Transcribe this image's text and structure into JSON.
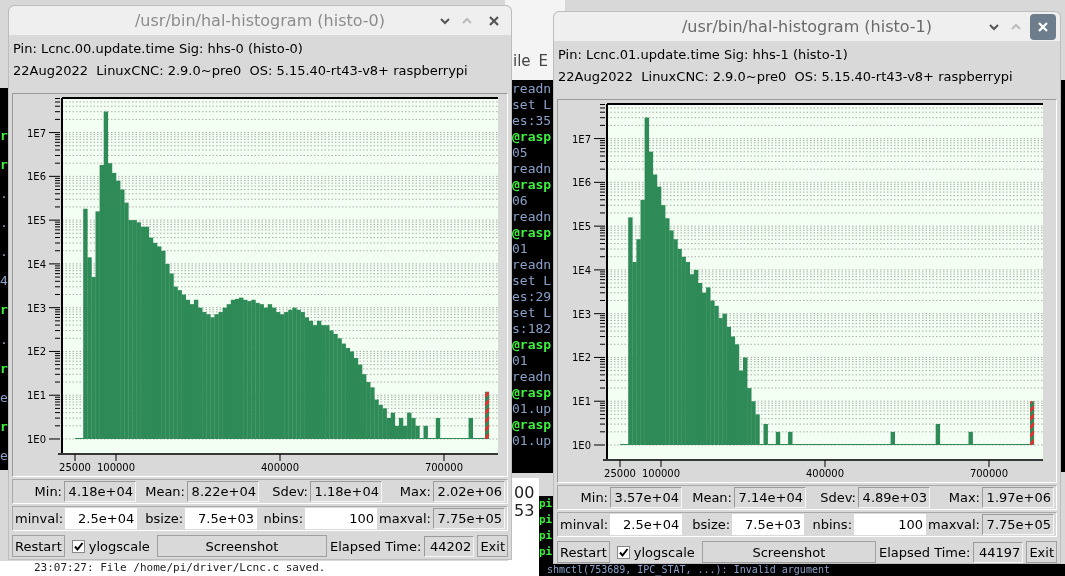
{
  "background": {
    "left_terminal": [
      {
        "text": "r",
        "kind": "prompt"
      },
      {
        "text": "r",
        "kind": "prompt"
      },
      {
        "text": ".",
        "kind": "output"
      },
      {
        "text": ".",
        "kind": "output"
      },
      {
        "text": ".",
        "kind": "output"
      },
      {
        "text": "4",
        "kind": "output"
      },
      {
        "text": "r",
        "kind": "prompt"
      },
      {
        "text": ".",
        "kind": "output"
      },
      {
        "text": "r",
        "kind": "prompt"
      },
      {
        "text": "e",
        "kind": "output"
      },
      {
        "text": "r",
        "kind": "prompt"
      },
      {
        "text": "e",
        "kind": "output"
      }
    ],
    "editor_menu": [
      "ile",
      "E"
    ],
    "middle_terminal": [
      {
        "text": "readn",
        "kind": "output"
      },
      {
        "text": "set L",
        "kind": "output"
      },
      {
        "text": "es:35",
        "kind": "output"
      },
      {
        "text": "@rasp",
        "kind": "prompt"
      },
      {
        "text": "05",
        "kind": "output"
      },
      {
        "text": "readn",
        "kind": "output"
      },
      {
        "text": "@rasp",
        "kind": "prompt"
      },
      {
        "text": "06",
        "kind": "output"
      },
      {
        "text": "readn",
        "kind": "output"
      },
      {
        "text": "@rasp",
        "kind": "prompt"
      },
      {
        "text": "01",
        "kind": "output"
      },
      {
        "text": "readn",
        "kind": "output"
      },
      {
        "text": "set L",
        "kind": "output"
      },
      {
        "text": "es:29",
        "kind": "output"
      },
      {
        "text": "set L",
        "kind": "output"
      },
      {
        "text": "s:182",
        "kind": "output"
      },
      {
        "text": "@rasp",
        "kind": "prompt"
      },
      {
        "text": "01",
        "kind": "output"
      },
      {
        "text": "readn",
        "kind": "output"
      },
      {
        "text": "@rasp",
        "kind": "prompt"
      },
      {
        "text": "01.up",
        "kind": "output"
      },
      {
        "text": "@rasp",
        "kind": "prompt"
      },
      {
        "text": "01.up",
        "kind": "output"
      }
    ],
    "log_panel": [
      "00",
      "53"
    ],
    "pi_terminal": [
      "pi",
      "pi",
      "pi",
      "pi"
    ],
    "status_message": "23:07:27: File /home/pi/driver/Lcnc.c saved.",
    "bottom_terminal": "shmctl(753689, IPC_STAT, ...): Invalid argument"
  },
  "windows": [
    {
      "title": "/usr/bin/hal-histogram (histo-0)",
      "active": false,
      "info": [
        "Pin: Lcnc.00.update.time Sig: hhs-0 (histo-0)",
        "22Aug2022  LinuxCNC: 2.9.0~pre0  OS: 5.15.40-rt43-v8+ raspberrypi"
      ],
      "histogram": {
        "y_axis_labels": [
          "1E7",
          "1E6",
          "1E5",
          "1E4",
          "1E3",
          "1E2",
          "1E1",
          "1E0"
        ],
        "x_axis_labels": [
          "25000",
          "100000",
          "400000",
          "700000"
        ]
      },
      "stats": [
        {
          "label": "Min:",
          "value": "4.18e+04"
        },
        {
          "label": "Mean:",
          "value": "8.22e+04"
        },
        {
          "label": "Sdev:",
          "value": "1.18e+04"
        },
        {
          "label": "Max:",
          "value": "2.02e+06"
        }
      ],
      "params": [
        {
          "label": "minval:",
          "value": "2.5e+04",
          "editable": true
        },
        {
          "label": "bsize:",
          "value": "7.5e+03",
          "editable": true
        },
        {
          "label": "nbins:",
          "value": "100",
          "editable": true
        },
        {
          "label": "maxval:",
          "value": "7.75e+05",
          "editable": false
        }
      ],
      "controls": {
        "restart": "Restart",
        "ylogscale": {
          "label": "ylogscale",
          "checked": true
        },
        "screenshot": "Screenshot",
        "elapsed_label": "Elapsed Time:",
        "elapsed": "44202",
        "exit": "Exit"
      }
    },
    {
      "title": "/usr/bin/hal-histogram (histo-1)",
      "active": true,
      "info": [
        "Pin: Lcnc.01.update.time Sig: hhs-1 (histo-1)",
        "22Aug2022  LinuxCNC: 2.9.0~pre0  OS: 5.15.40-rt43-v8+ raspberrypi"
      ],
      "histogram": {
        "y_axis_labels": [
          "1E7",
          "1E6",
          "1E5",
          "1E4",
          "1E3",
          "1E2",
          "1E1",
          "1E0"
        ],
        "x_axis_labels": [
          "25000",
          "100000",
          "400000",
          "700000"
        ]
      },
      "stats": [
        {
          "label": "Min:",
          "value": "3.57e+04"
        },
        {
          "label": "Mean:",
          "value": "7.14e+04"
        },
        {
          "label": "Sdev:",
          "value": "4.89e+03"
        },
        {
          "label": "Max:",
          "value": "1.97e+06"
        }
      ],
      "params": [
        {
          "label": "minval:",
          "value": "2.5e+04",
          "editable": true
        },
        {
          "label": "bsize:",
          "value": "7.5e+03",
          "editable": true
        },
        {
          "label": "nbins:",
          "value": "100",
          "editable": true
        },
        {
          "label": "maxval:",
          "value": "7.75e+05",
          "editable": false
        }
      ],
      "controls": {
        "restart": "Restart",
        "ylogscale": {
          "label": "ylogscale",
          "checked": true
        },
        "screenshot": "Screenshot",
        "elapsed_label": "Elapsed Time:",
        "elapsed": "44197",
        "exit": "Exit"
      }
    }
  ]
}
